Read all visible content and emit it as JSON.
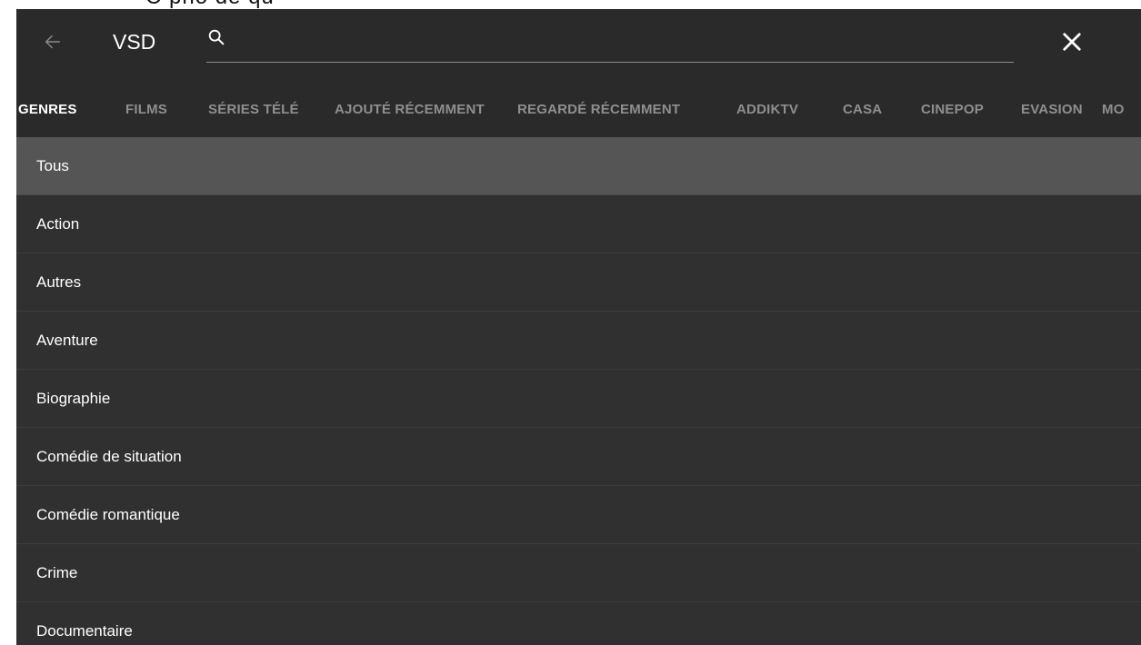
{
  "top_strip": {
    "cut_text": "C pho de qu"
  },
  "toolbar": {
    "back_icon": "arrow-left-icon",
    "title": "VSD",
    "search": {
      "icon": "search-icon",
      "value": "",
      "placeholder": ""
    },
    "close_icon": "close-icon"
  },
  "tabs": {
    "active_index": 0,
    "items": [
      {
        "label": "GENRES"
      },
      {
        "label": "FILMS"
      },
      {
        "label": "SÉRIES TÉLÉ"
      },
      {
        "label": "AJOUTÉ RÉCEMMENT"
      },
      {
        "label": "REGARDÉ RÉCEMMENT"
      },
      {
        "label": "ADDIKTV"
      },
      {
        "label": "CASA"
      },
      {
        "label": "CINEPOP"
      },
      {
        "label": "EVASION"
      },
      {
        "label": "MO"
      }
    ]
  },
  "genres": {
    "selected_index": 0,
    "items": [
      {
        "label": "Tous"
      },
      {
        "label": "Action"
      },
      {
        "label": "Autres"
      },
      {
        "label": "Aventure"
      },
      {
        "label": "Biographie"
      },
      {
        "label": "Comédie de situation"
      },
      {
        "label": "Comédie romantique"
      },
      {
        "label": "Crime"
      },
      {
        "label": "Documentaire"
      }
    ]
  },
  "colors": {
    "toolbar_bg": "#2a2a2a",
    "list_bg": "#303030",
    "selected_row_bg": "#555555",
    "active_tab": "#ffffff",
    "inactive_tab": "#8f8f8f"
  }
}
